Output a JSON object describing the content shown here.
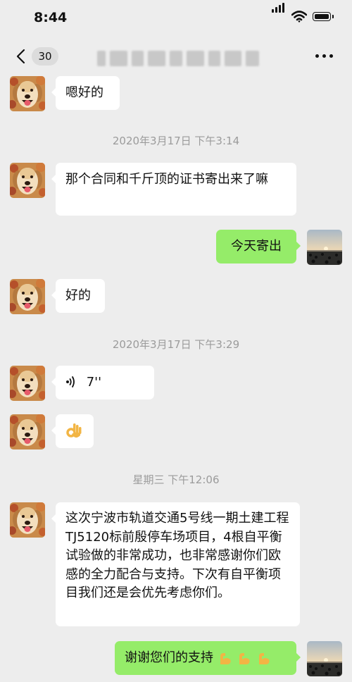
{
  "status_bar": {
    "time": "8:44"
  },
  "nav": {
    "unread_count": "30"
  },
  "messages": {
    "m1": "嗯好的",
    "ts1": "2020年3月17日 下午3:14",
    "m2": "那个合同和千斤顶的证书寄出来了嘛",
    "m3": "今天寄出",
    "m4": "好的",
    "ts2": "2020年3月17日 下午3:29",
    "voice_duration": "7''",
    "ts3": "星期三 下午12:06",
    "m7": "这次宁波市轨道交通5号线一期土建工程TJ5120标前殷停车场项目，4根自平衡试验做的非常成功，也非常感谢你们欧感的全力配合与支持。下次有自平衡项目我们还是会优先考虑你们。",
    "m8": "谢谢您们的支持"
  },
  "icons": {
    "back": "chevron-left-icon",
    "more": "more-dots-icon",
    "voice": "voice-wave-icon",
    "ok_hand": "ok-hand-emoji",
    "strong": "flexed-biceps-emoji"
  },
  "colors": {
    "background": "#ededed",
    "received_bubble": "#ffffff",
    "sent_bubble": "#95ec69",
    "timestamp": "#9b9b9b"
  }
}
